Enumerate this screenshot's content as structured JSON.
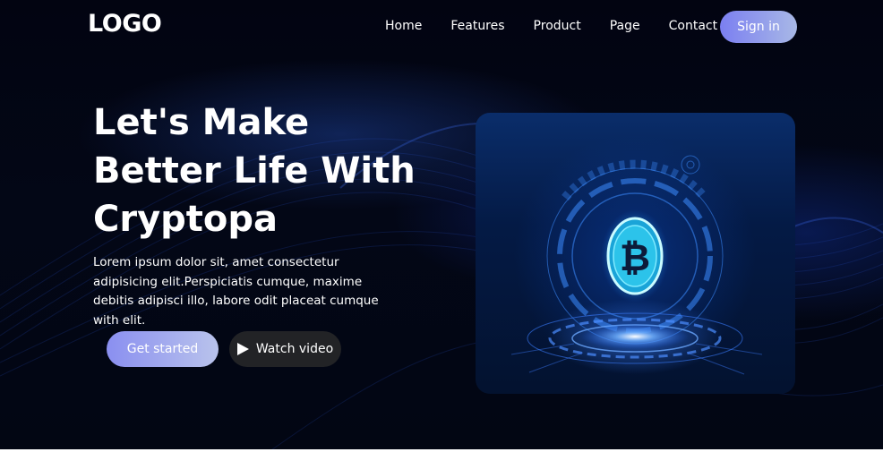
{
  "brand": {
    "logo_text": "LOGO"
  },
  "nav": {
    "items": [
      {
        "label": "Home"
      },
      {
        "label": "Features"
      },
      {
        "label": "Product"
      },
      {
        "label": "Page"
      },
      {
        "label": "Contact"
      }
    ],
    "signin_label": "Sign in"
  },
  "hero": {
    "title_lines": [
      "Let's Make",
      "Better Life With",
      "Cryptopa"
    ],
    "description": "Lorem ipsum dolor sit, amet consectetur adipisicing elit.Perspiciatis cumque, maxime debitis adipisci illo, labore odit placeat cumque with elit.",
    "primary_button": "Get started",
    "secondary_button": "Watch video"
  },
  "card": {
    "symbol": "₿",
    "icon": "bitcoin-hologram"
  },
  "colors": {
    "background": "#01030c",
    "accent_gradient_start": "#7b7ff1",
    "accent_gradient_end": "#a8b8e6",
    "video_button": "#222326",
    "glow_blue": "#2f7bff"
  }
}
